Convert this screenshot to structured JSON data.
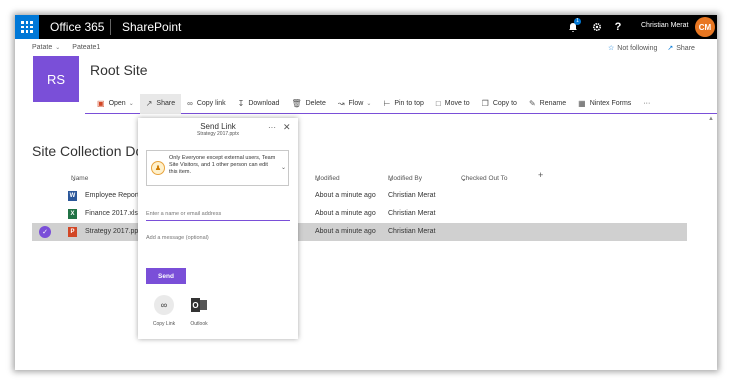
{
  "suitebar": {
    "brand": "Office 365",
    "app": "SharePoint",
    "notification_count": "1",
    "settings_icon": "gear-icon",
    "help_label": "?",
    "user_name": "Christian Merat"
  },
  "breadcrumb": {
    "items": [
      "Patate",
      "Pateate1"
    ]
  },
  "follow": {
    "not_following": "Not following",
    "share": "Share"
  },
  "site": {
    "logo_initials": "RS",
    "title": "Root Site",
    "accent_color": "#7a4fd8"
  },
  "commandbar": {
    "items": [
      {
        "label": "Open",
        "icon": "powerpoint-icon",
        "dropdown": true
      },
      {
        "label": "Share",
        "icon": "share-icon",
        "dropdown": false
      },
      {
        "label": "Copy link",
        "icon": "link-icon",
        "dropdown": false
      },
      {
        "label": "Download",
        "icon": "download-icon",
        "dropdown": false
      },
      {
        "label": "Delete",
        "icon": "trash-icon",
        "dropdown": false
      },
      {
        "label": "Flow",
        "icon": "flow-icon",
        "dropdown": true
      },
      {
        "label": "Pin to top",
        "icon": "pin-icon",
        "dropdown": false
      },
      {
        "label": "Move to",
        "icon": "move-icon",
        "dropdown": false
      },
      {
        "label": "Copy to",
        "icon": "copy-icon",
        "dropdown": false
      },
      {
        "label": "Rename",
        "icon": "rename-icon",
        "dropdown": false
      },
      {
        "label": "Nintex Forms",
        "icon": "nintex-icon",
        "dropdown": false
      },
      {
        "label": "···",
        "icon": "more-icon",
        "dropdown": false
      }
    ]
  },
  "library": {
    "title": "Site Collection Documents",
    "columns": [
      "Name",
      "Modified",
      "Modified By",
      "Checked Out To",
      "+"
    ],
    "rows": [
      {
        "name": "Employee Report.docx",
        "modified": "About a minute ago",
        "modified_by": "Christian Merat",
        "type": "word",
        "selected": false
      },
      {
        "name": "Finance 2017.xlsx",
        "modified": "About a minute ago",
        "modified_by": "Christian Merat",
        "type": "excel",
        "selected": false
      },
      {
        "name": "Strategy 2017.pptx",
        "modified": "About a minute ago",
        "modified_by": "Christian Merat",
        "type": "powerpoint",
        "selected": true
      }
    ]
  },
  "share_dialog": {
    "title": "Send Link",
    "subtitle": "Strategy 2017.pptx",
    "permission_text": "Only Everyone except external users, Team Site Visitors, and 1 other person can edit this item.",
    "recipient_placeholder": "Enter a name or email address",
    "message_placeholder": "Add a message (optional)",
    "send_label": "Send",
    "options": [
      {
        "label": "Copy Link",
        "icon": "link-icon"
      },
      {
        "label": "Outlook",
        "icon": "outlook-icon"
      }
    ]
  }
}
